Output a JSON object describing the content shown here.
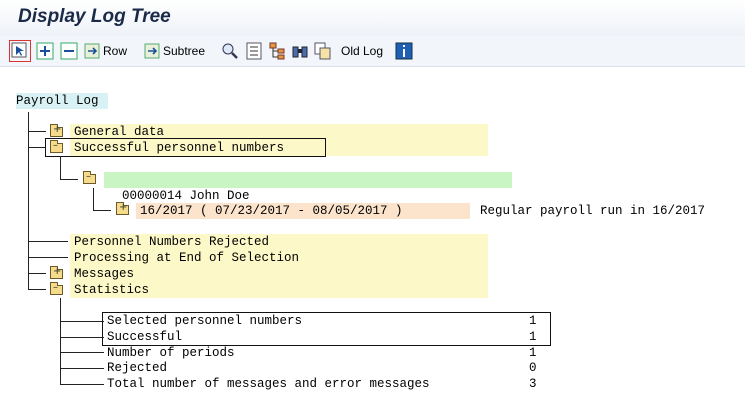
{
  "window": {
    "title": "Display Log Tree"
  },
  "toolbar": {
    "row_label": "Row",
    "subtree_label": "Subtree",
    "old_log_label": "Old Log",
    "icons": [
      "select-icon",
      "expand-icon",
      "collapse-icon",
      "row-icon",
      "subtree-icon",
      "find-icon",
      "list-icon",
      "hierarchy-icon",
      "binoculars-icon",
      "copy-icon",
      "info-icon"
    ]
  },
  "tree": {
    "root": "Payroll Log",
    "general_data": "General data",
    "successful_personnel": "Successful personnel numbers",
    "person_number": "00000014",
    "person_name": "John Doe",
    "period": "16/2017 ( 07/23/2017 - 08/05/2017 )",
    "period_note": "Regular payroll run in 16/2017",
    "rejected_personnel": "Personnel Numbers Rejected",
    "processing_end": "Processing at End of Selection",
    "messages": "Messages",
    "statistics": "Statistics",
    "stats": [
      {
        "label": "Selected personnel numbers",
        "value": "1"
      },
      {
        "label": "Successful",
        "value": "1"
      },
      {
        "label": "Number of periods",
        "value": "1"
      },
      {
        "label": "Rejected",
        "value": "0"
      },
      {
        "label": "Total number of messages and error messages",
        "value": "3"
      }
    ]
  },
  "colors": {
    "node_bg": "#fdf8c7",
    "person_bg": "#c9f5c4",
    "period_bg": "#fbe3cc",
    "title": "#1a2a48"
  }
}
